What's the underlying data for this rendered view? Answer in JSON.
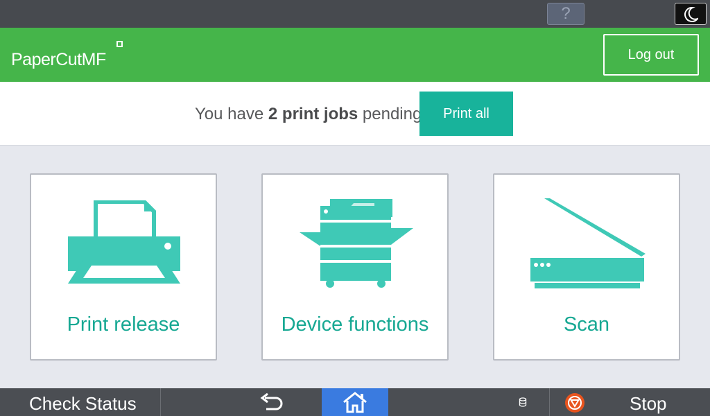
{
  "system_bar": {
    "help_label": "?",
    "night_mode_icon": "moon-icon"
  },
  "header": {
    "logo_main": "PaperCut",
    "logo_suffix": "MF",
    "logout_label": "Log out",
    "brand_color": "#45b54a"
  },
  "pending": {
    "prefix": "You have ",
    "count_text": "2 print jobs",
    "suffix": " pending",
    "print_all_label": "Print all",
    "accent_color": "#18b39b"
  },
  "tiles": [
    {
      "label": "Print release",
      "icon": "printer-icon"
    },
    {
      "label": "Device functions",
      "icon": "copier-icon"
    },
    {
      "label": "Scan",
      "icon": "scanner-icon"
    }
  ],
  "bottom_bar": {
    "check_status_label": "Check Status",
    "back_icon": "back-arrow-icon",
    "home_icon": "home-icon",
    "data_icon": "database-icon",
    "stop_icon": "stop-icon",
    "stop_label": "Stop"
  }
}
